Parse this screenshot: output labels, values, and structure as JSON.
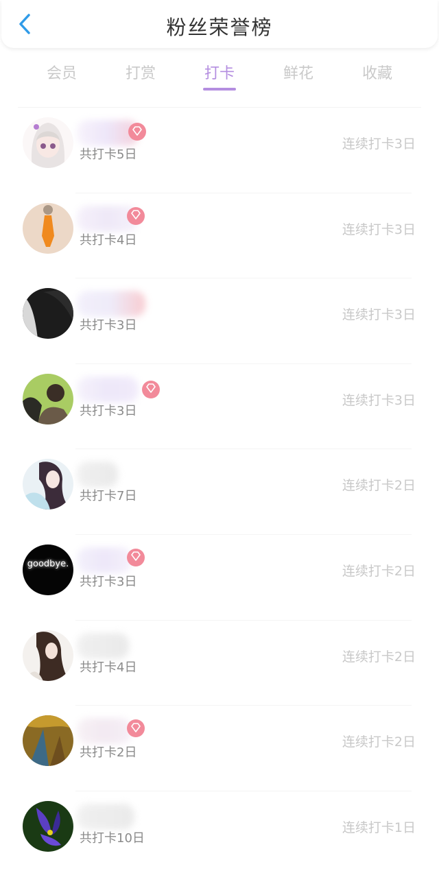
{
  "header": {
    "title": "粉丝荣誉榜"
  },
  "tabs": [
    {
      "label": "会员"
    },
    {
      "label": "打赏"
    },
    {
      "label": "打卡"
    },
    {
      "label": "鲜花"
    },
    {
      "label": "收藏"
    }
  ],
  "active_tab": "打卡",
  "colors": {
    "accent": "#b48ee0",
    "back_icon": "#2f9be8",
    "vip_badge": "#f28a9a"
  },
  "rows": [
    {
      "total": "共打卡5日",
      "streak": "连续打卡3日",
      "vip": true
    },
    {
      "total": "共打卡4日",
      "streak": "连续打卡3日",
      "vip": true
    },
    {
      "total": "共打卡3日",
      "streak": "连续打卡3日",
      "vip": false
    },
    {
      "total": "共打卡3日",
      "streak": "连续打卡3日",
      "vip": true
    },
    {
      "total": "共打卡7日",
      "streak": "连续打卡2日",
      "vip": false
    },
    {
      "total": "共打卡3日",
      "streak": "连续打卡2日",
      "vip": true
    },
    {
      "total": "共打卡4日",
      "streak": "连续打卡2日",
      "vip": false
    },
    {
      "total": "共打卡2日",
      "streak": "连续打卡2日",
      "vip": true
    },
    {
      "total": "共打卡10日",
      "streak": "连续打卡1日",
      "vip": false
    }
  ]
}
